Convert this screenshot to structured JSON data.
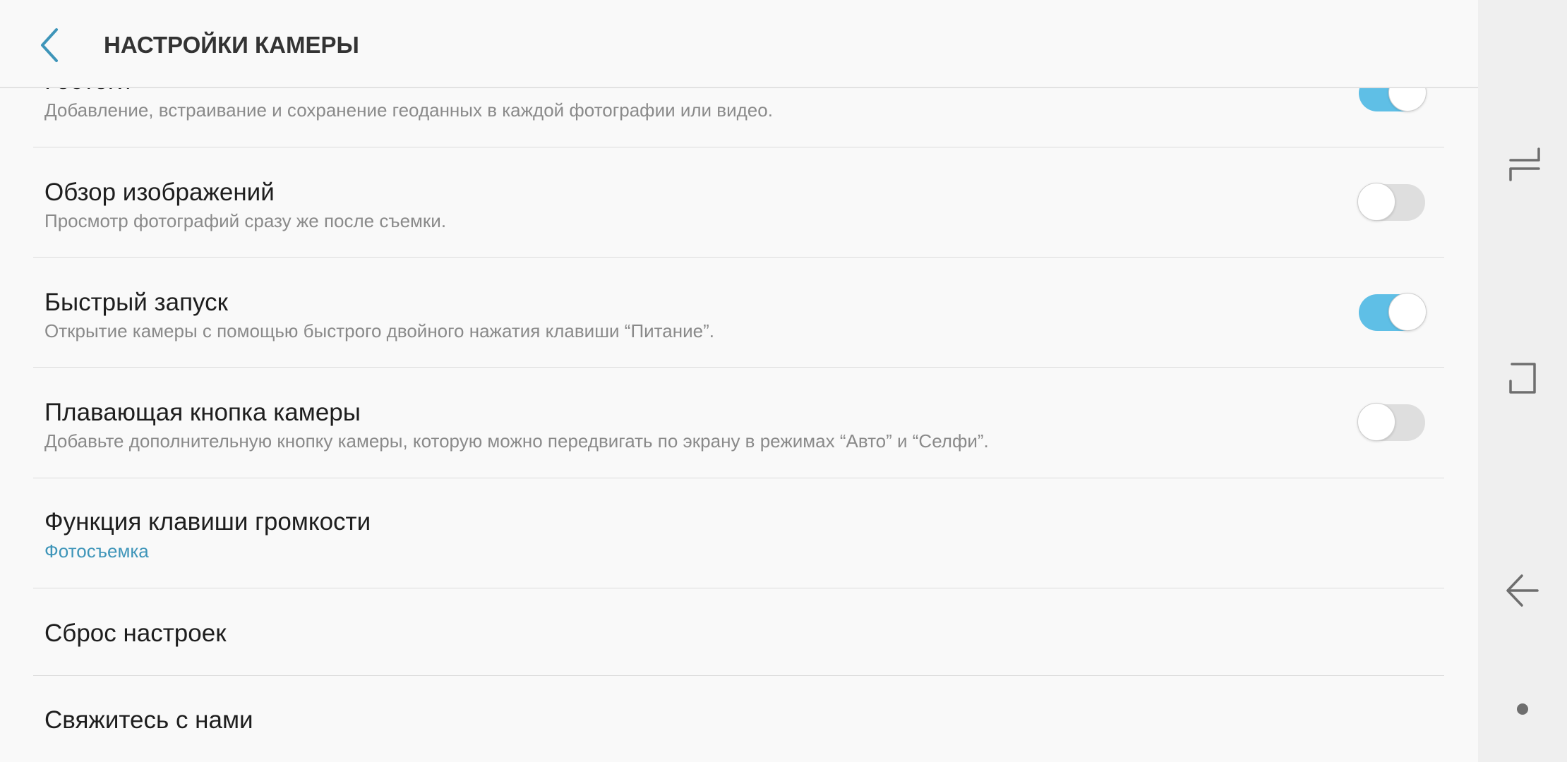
{
  "header": {
    "title": "НАСТРОЙКИ КАМЕРЫ",
    "back_icon": "chevron-left-icon"
  },
  "settings": [
    {
      "id": "geotag",
      "title": "Геотеги",
      "subtitle": "Добавление, встраивание и сохранение геоданных в каждой фотографии или видео.",
      "toggle": "on"
    },
    {
      "id": "review",
      "title": "Обзор изображений",
      "subtitle": "Просмотр фотографий сразу же после съемки.",
      "toggle": "off"
    },
    {
      "id": "quick-launch",
      "title": "Быстрый запуск",
      "subtitle": "Открытие камеры с помощью быстрого двойного нажатия клавиши “Питание”.",
      "toggle": "on"
    },
    {
      "id": "floating-button",
      "title": "Плавающая кнопка камеры",
      "subtitle": "Добавьте дополнительную кнопку камеры, которую можно передвигать по экрану в режимах “Авто” и “Селфи”.",
      "toggle": "off"
    },
    {
      "id": "volume-key",
      "title": "Функция клавиши громкости",
      "value": "Фотосъемка"
    },
    {
      "id": "reset",
      "title": "Сброс настроек"
    },
    {
      "id": "contact",
      "title": "Свяжитесь с нами"
    }
  ],
  "navbar": {
    "items": [
      "recent-apps-icon",
      "home-icon",
      "back-arrow-icon",
      "hide-navbar-dot-icon"
    ]
  },
  "colors": {
    "accent": "#3e95b9",
    "toggle_on": "#5fbfe6",
    "toggle_off": "#dedede",
    "background": "#f9f9f9",
    "navbar": "#efefef"
  }
}
